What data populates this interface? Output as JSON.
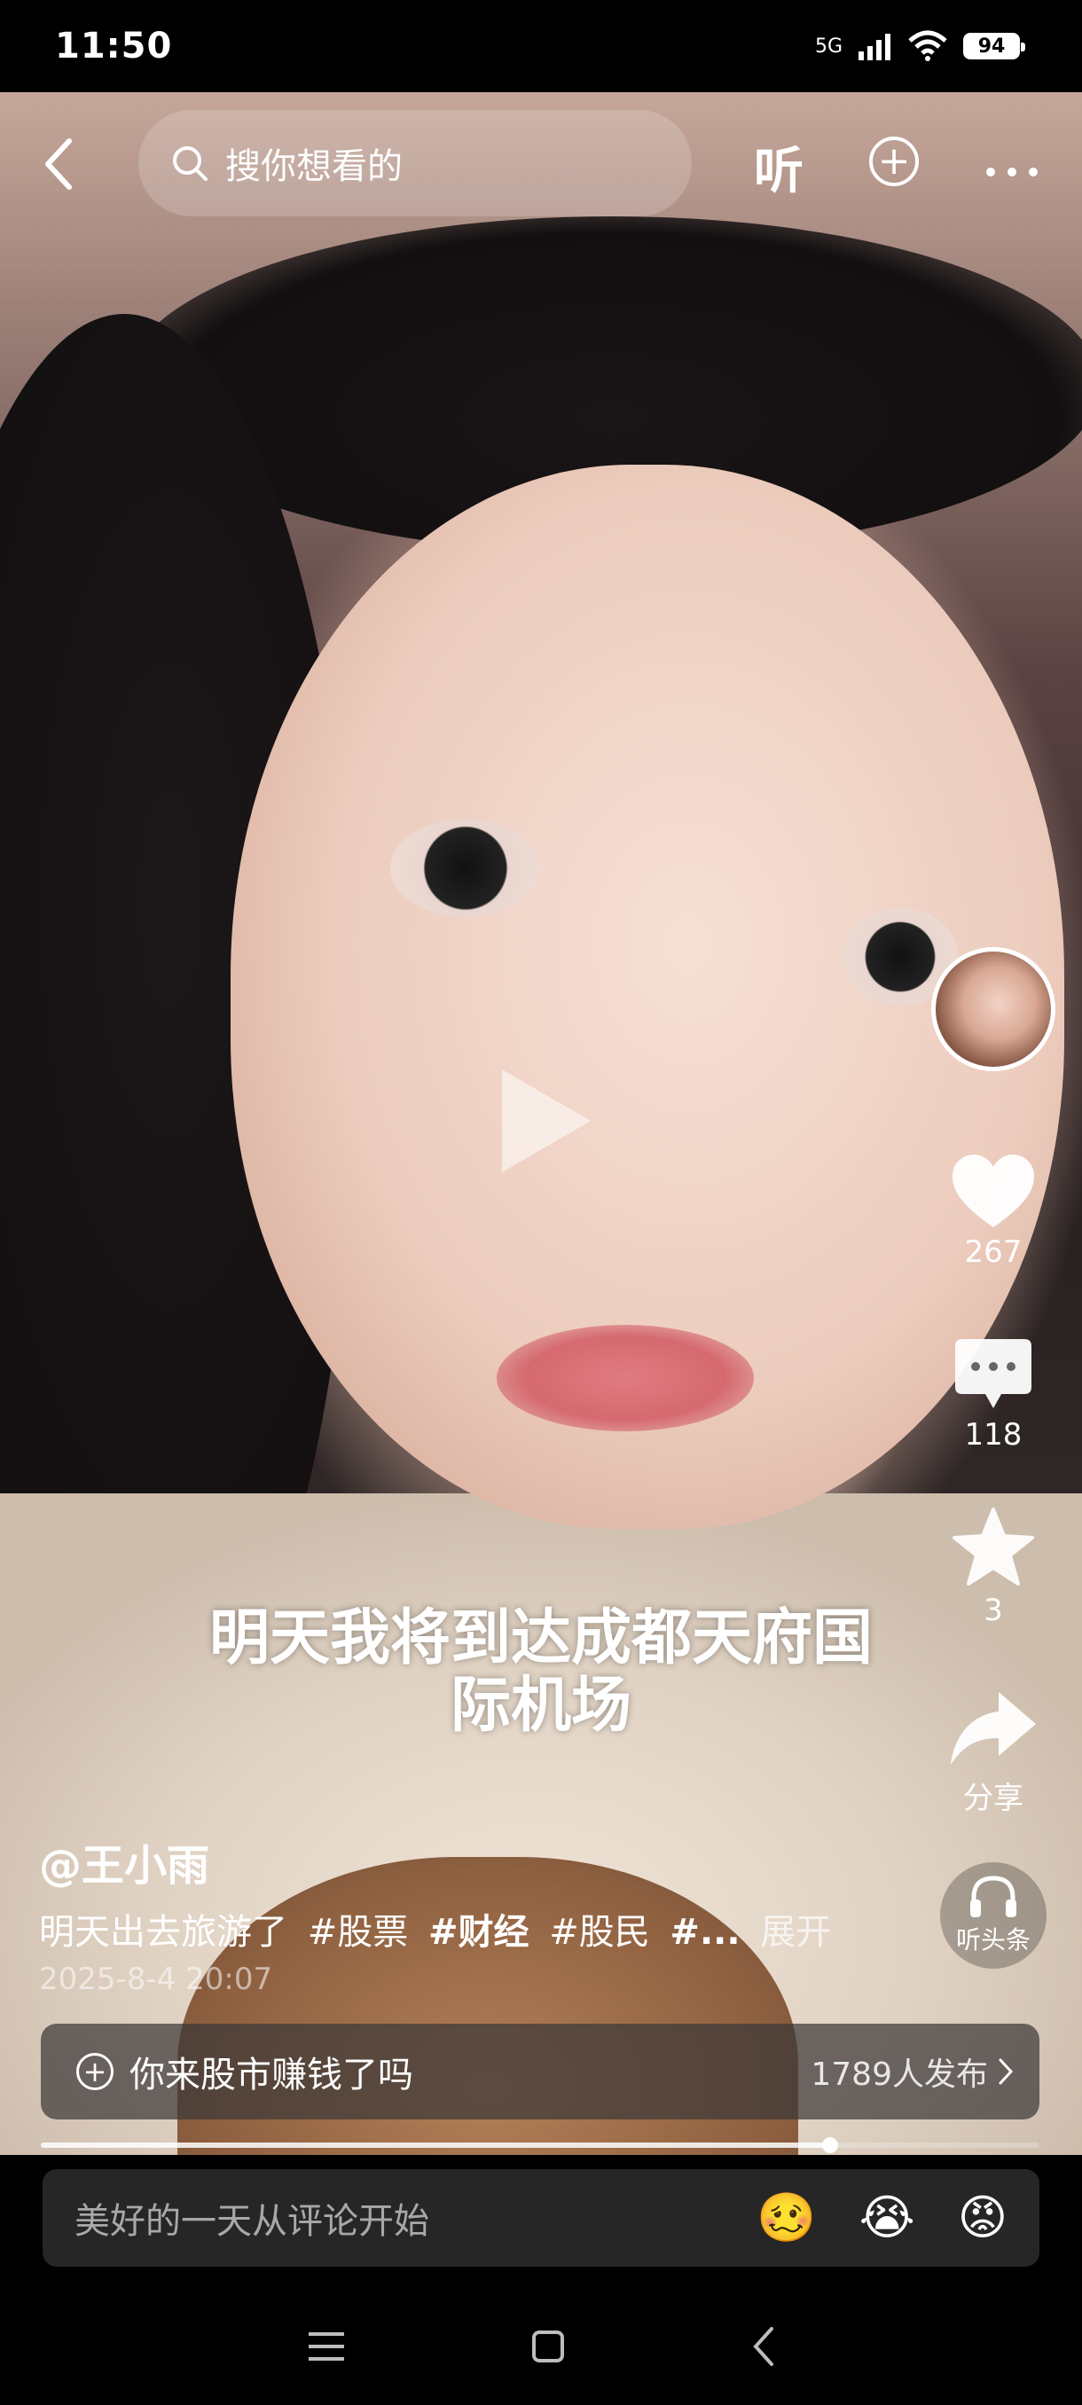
{
  "status_bar": {
    "time": "11:50",
    "network": "5G",
    "battery": "94"
  },
  "top_bar": {
    "search_placeholder": "搜你想看的",
    "listen_label": "听"
  },
  "video": {
    "caption_line1": "明天我将到达成都天府国",
    "caption_line2": "际机场"
  },
  "side_actions": {
    "like_count": "267",
    "comment_count": "118",
    "favorite_count": "3",
    "share_label": "分享",
    "listen_headlines_label": "听头条"
  },
  "post": {
    "author": "@王小雨",
    "desc_text": "明天出去旅游了",
    "tags": [
      "#股票",
      "#财经",
      "#股民",
      "#..."
    ],
    "expand_label": "展开",
    "date": "2025-8-4 20:07"
  },
  "topic_bar": {
    "topic": "你来股市赚钱了吗",
    "participants": "1789人发布"
  },
  "playback": {
    "progress": 0.79
  },
  "comment_bar": {
    "placeholder": "美好的一天从评论开始",
    "emoji_1": "🥴",
    "emoji_2": "😭",
    "emoji_3": "😡"
  }
}
